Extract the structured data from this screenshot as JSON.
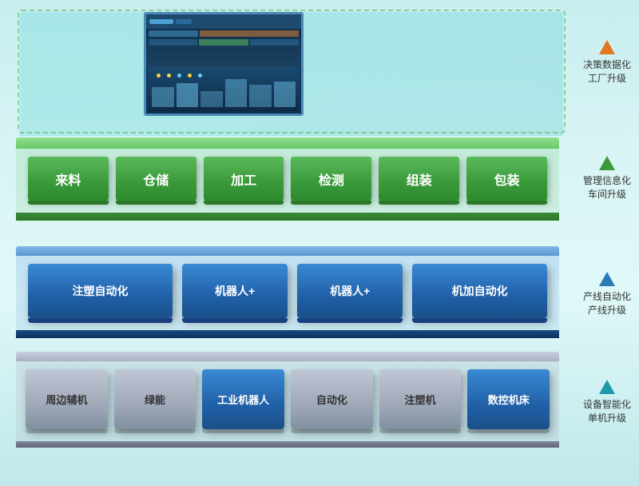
{
  "layers": {
    "decision": {
      "label_line1": "决策数据化",
      "label_line2": "工厂升级",
      "arrow_color": "#e07820"
    },
    "management": {
      "label_line1": "管理信息化",
      "label_line2": "车间升级",
      "arrow_color": "#3a9a3a",
      "boxes": [
        "来料",
        "仓储",
        "加工",
        "检测",
        "组装",
        "包装"
      ]
    },
    "production": {
      "label_line1": "产线自动化",
      "label_line2": "产线升级",
      "arrow_color": "#2a7ab8",
      "boxes": [
        "注塑自动化",
        "机器人+",
        "机器人+",
        "机加自动化"
      ]
    },
    "equipment": {
      "label_line1": "设备智能化",
      "label_line2": "单机升级",
      "arrow_color": "#1a9aaa",
      "boxes": [
        {
          "text": "周边辅机",
          "type": "gray"
        },
        {
          "text": "绿能",
          "type": "gray"
        },
        {
          "text": "工业机器人",
          "type": "blue"
        },
        {
          "text": "自动化",
          "type": "gray"
        },
        {
          "text": "注塑机",
          "type": "gray"
        },
        {
          "text": "数控机床",
          "type": "blue"
        }
      ]
    }
  }
}
